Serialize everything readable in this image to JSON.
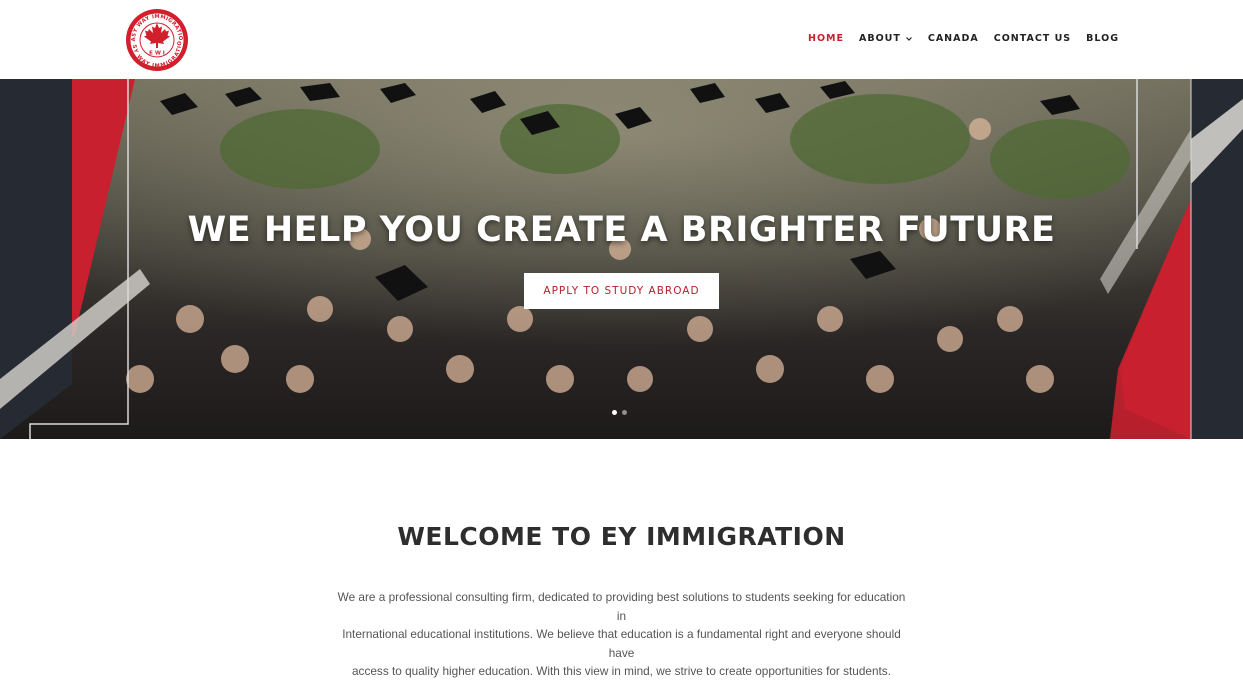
{
  "header": {
    "logo": {
      "top_text": "EASY WAY IMMIGRATION",
      "bottom_text": "EASY WAY IMMIGRATION",
      "center_text": "E W I",
      "icon": "maple-leaf-icon"
    },
    "nav": [
      {
        "label": "HOME",
        "active": true
      },
      {
        "label": "ABOUT",
        "has_dropdown": true
      },
      {
        "label": "CANADA"
      },
      {
        "label": "CONTACT US"
      },
      {
        "label": "BLOG"
      }
    ]
  },
  "hero": {
    "title": "WE HELP YOU CREATE A BRIGHTER FUTURE",
    "button_label": "APPLY TO STUDY ABROAD",
    "slides": 2,
    "active_slide": 1
  },
  "welcome": {
    "title": "WELCOME TO EY IMMIGRATION",
    "lines": [
      "We are a professional consulting firm, dedicated to providing best solutions to students seeking for education in",
      "International educational institutions. We believe that education is a fundamental right and everyone should have",
      "access to quality higher education. With this view in mind, we strive to create opportunities for students."
    ]
  },
  "colors": {
    "brand_red": "#c8202f",
    "dark_panel": "#262b33",
    "text_dark": "#2e2e2e"
  }
}
